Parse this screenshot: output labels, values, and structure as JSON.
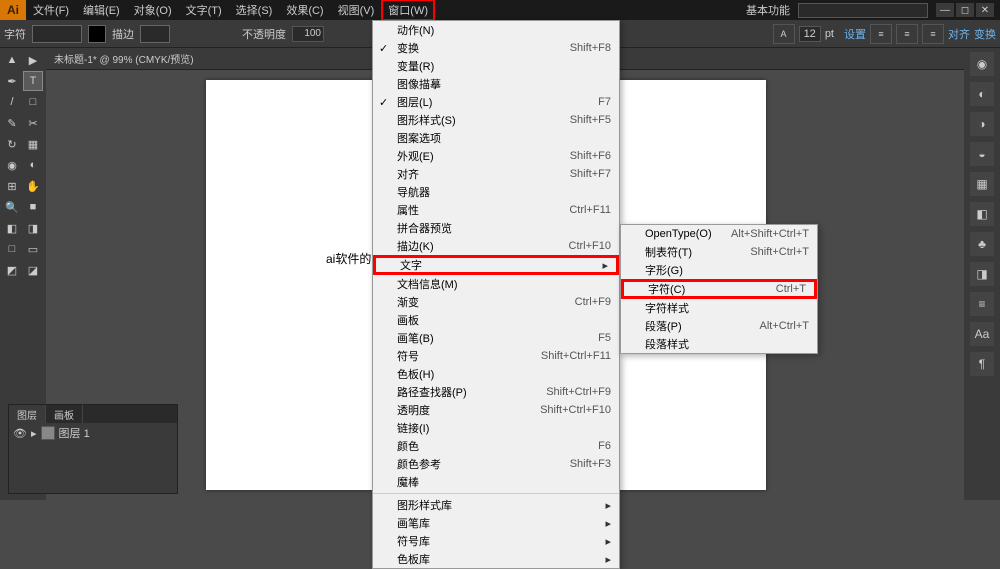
{
  "app": {
    "logo": "Ai",
    "workspace_label": "基本功能"
  },
  "menubar": [
    "文件(F)",
    "编辑(E)",
    "对象(O)",
    "文字(T)",
    "选择(S)",
    "效果(C)",
    "视图(V)",
    "窗口(W)"
  ],
  "menu_highlight_index": 7,
  "optbar": {
    "label": "字符",
    "stroke_label": "描边",
    "opacity_label": "不透明度",
    "opacity_value": "100",
    "pt_value": "12",
    "pt_unit": "pt",
    "align_label": "对齐",
    "transform_label": "变换",
    "settings_label": "设置"
  },
  "doc": {
    "tab": "未标题-1* @ 99% (CMYK/预览)",
    "canvas_text": "ai软件的文"
  },
  "window_menu": [
    {
      "label": "动作(N)",
      "shortcut": ""
    },
    {
      "label": "变换",
      "shortcut": "Shift+F8",
      "check": true
    },
    {
      "label": "变量(R)",
      "shortcut": ""
    },
    {
      "label": "图像描摹",
      "shortcut": ""
    },
    {
      "label": "图层(L)",
      "shortcut": "F7",
      "check": true
    },
    {
      "label": "图形样式(S)",
      "shortcut": "Shift+F5"
    },
    {
      "label": "图案选项",
      "shortcut": ""
    },
    {
      "label": "外观(E)",
      "shortcut": "Shift+F6"
    },
    {
      "label": "对齐",
      "shortcut": "Shift+F7"
    },
    {
      "label": "导航器",
      "shortcut": ""
    },
    {
      "label": "属性",
      "shortcut": "Ctrl+F11"
    },
    {
      "label": "拼合器预览",
      "shortcut": ""
    },
    {
      "label": "描边(K)",
      "shortcut": "Ctrl+F10"
    },
    {
      "label": "文字",
      "submenu": true,
      "highlight": true
    },
    {
      "label": "文档信息(M)",
      "shortcut": ""
    },
    {
      "label": "渐变",
      "shortcut": "Ctrl+F9"
    },
    {
      "label": "画板",
      "shortcut": ""
    },
    {
      "label": "画笔(B)",
      "shortcut": "F5"
    },
    {
      "label": "符号",
      "shortcut": "Shift+Ctrl+F11"
    },
    {
      "label": "色板(H)",
      "shortcut": ""
    },
    {
      "label": "路径查找器(P)",
      "shortcut": "Shift+Ctrl+F9"
    },
    {
      "label": "透明度",
      "shortcut": "Shift+Ctrl+F10"
    },
    {
      "label": "链接(I)",
      "shortcut": ""
    },
    {
      "label": "颜色",
      "shortcut": "F6"
    },
    {
      "label": "颜色参考",
      "shortcut": "Shift+F3"
    },
    {
      "label": "魔棒",
      "shortcut": ""
    },
    {
      "sep": true
    },
    {
      "label": "图形样式库",
      "submenu": true
    },
    {
      "label": "画笔库",
      "submenu": true
    },
    {
      "label": "符号库",
      "submenu": true
    },
    {
      "label": "色板库",
      "submenu": true
    }
  ],
  "text_submenu": [
    {
      "label": "OpenType(O)",
      "shortcut": "Alt+Shift+Ctrl+T"
    },
    {
      "label": "制表符(T)",
      "shortcut": "Shift+Ctrl+T"
    },
    {
      "label": "字形(G)",
      "shortcut": ""
    },
    {
      "label": "字符(C)",
      "shortcut": "Ctrl+T",
      "highlight": true
    },
    {
      "label": "字符样式",
      "shortcut": ""
    },
    {
      "label": "段落(P)",
      "shortcut": "Alt+Ctrl+T"
    },
    {
      "label": "段落样式",
      "shortcut": ""
    }
  ],
  "layers": {
    "tab1": "图层",
    "tab2": "画板",
    "row_name": "图层 1"
  },
  "colors": {
    "fill": "#000000",
    "stroke_none": "#ffffff"
  }
}
